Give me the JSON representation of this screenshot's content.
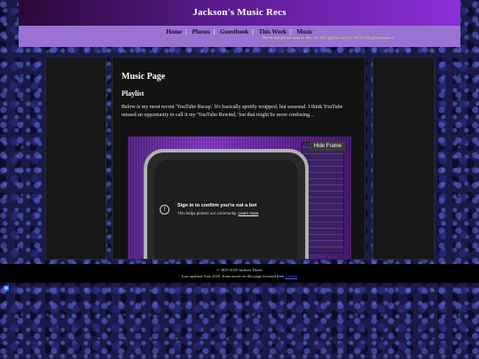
{
  "header": {
    "title": "Jackson's Music Recs"
  },
  "nav": {
    "items": [
      "Home",
      "Photos",
      "Guestbook",
      "This Week",
      "Music"
    ],
    "separator": "|",
    "marquee": "We're not gonna take it. No, we ain't gonna take it. We're not gonna take it"
  },
  "main": {
    "title": "Music Page",
    "section": "Playlist",
    "description": "Below is my most recent 'YouTube Recap.' It's basically spotify wrapped, but seasonal. I think YouTube missed an opportunity to call it my 'YouTube Rewind,' but that might be more confusing...",
    "video": {
      "hide_frame": "Hide Frame",
      "signin_title": "Sign in to confirm you're not a bot",
      "signin_sub": "This helps protect our community.",
      "learn_more": "Learn more"
    }
  },
  "footer": {
    "copyright": "© 2025-2025 Jackson Dyner",
    "updated": "Last updated June 2025. Some assets on this page licensed from",
    "link": "sources"
  },
  "colors": {
    "nav_bg": "#9a72d2",
    "header_accent": "#8a2fd8",
    "marquee": "#b6e08a"
  }
}
